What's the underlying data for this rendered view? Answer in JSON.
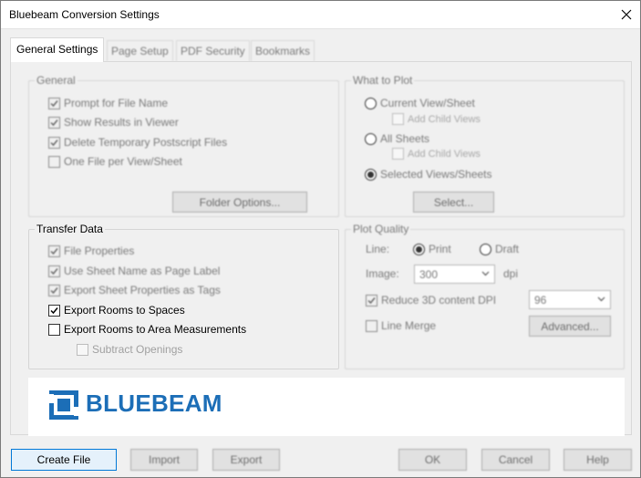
{
  "window": {
    "title": "Bluebeam Conversion Settings",
    "close_glyph": "✕"
  },
  "tabs": [
    {
      "label": "General Settings",
      "active": true
    },
    {
      "label": "Page Setup",
      "active": false
    },
    {
      "label": "PDF Security",
      "active": false
    },
    {
      "label": "Bookmarks",
      "active": false
    }
  ],
  "general": {
    "label": "General",
    "items": [
      {
        "label": "Prompt for File Name",
        "checked": true
      },
      {
        "label": "Show Results in Viewer",
        "checked": true
      },
      {
        "label": "Delete Temporary Postscript Files",
        "checked": true
      },
      {
        "label": "One File per View/Sheet",
        "checked": false
      }
    ],
    "folder_options_label": "Folder Options..."
  },
  "what_to_plot": {
    "label": "What to Plot",
    "current": "Current View/Sheet",
    "current_add_child": "Add Child Views",
    "all_sheets": "All Sheets",
    "all_add_child": "Add Child Views",
    "selected": "Selected Views/Sheets",
    "selected_value": "selected",
    "select_button": "Select..."
  },
  "transfer": {
    "label": "Transfer Data",
    "items": [
      {
        "label": "File Properties",
        "checked": true
      },
      {
        "label": "Use Sheet Name as Page Label",
        "checked": true
      },
      {
        "label": "Export Sheet Properties as Tags",
        "checked": true
      },
      {
        "label": "Export Rooms to Spaces",
        "checked": true
      },
      {
        "label": "Export Rooms to Area Measurements",
        "checked": false
      }
    ],
    "subtract": "Subtract Openings"
  },
  "plot_quality": {
    "label": "Plot Quality",
    "line_label": "Line:",
    "print": "Print",
    "draft": "Draft",
    "line_value": "Print",
    "image_label": "Image:",
    "image_value": "300",
    "dpi_label": "dpi",
    "reduce_label": "Reduce 3D content DPI",
    "reduce_checked": true,
    "reduce_value": "96",
    "line_merge": "Line Merge",
    "line_merge_checked": false,
    "advanced_button": "Advanced..."
  },
  "logo": {
    "text": "BLUEBEAM",
    "color": "#1c6eb7"
  },
  "footer": {
    "create": "Create File",
    "import": "Import",
    "export": "Export",
    "ok": "OK",
    "cancel": "Cancel",
    "help": "Help"
  },
  "colors": {
    "accent": "#0078d7",
    "brand": "#1c6eb7"
  }
}
